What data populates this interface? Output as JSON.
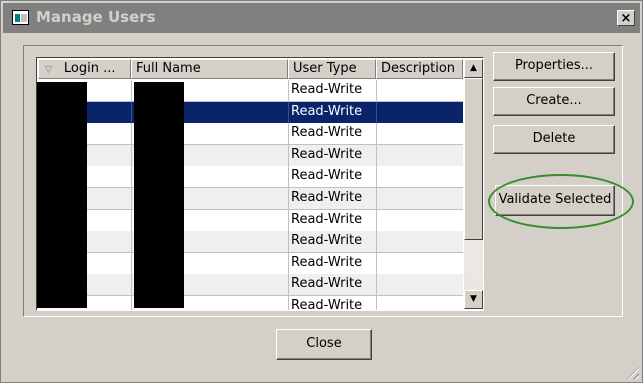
{
  "window": {
    "title": "Manage Users",
    "close_glyph": "×"
  },
  "grid": {
    "columns": [
      "Login ...",
      "Full Name",
      "User Type",
      "Description"
    ],
    "sort_glyph": "▽",
    "rows": [
      {
        "user_type": "Read-Write",
        "description": ""
      },
      {
        "user_type": "Read-Write",
        "description": "",
        "selected": true
      },
      {
        "user_type": "Read-Write",
        "description": ""
      },
      {
        "user_type": "Read-Write",
        "description": ""
      },
      {
        "user_type": "Read-Write",
        "description": ""
      },
      {
        "user_type": "Read-Write",
        "description": ""
      },
      {
        "user_type": "Read-Write",
        "description": ""
      },
      {
        "user_type": "Read-Write",
        "description": ""
      },
      {
        "user_type": "Read-Write",
        "description": ""
      },
      {
        "user_type": "Read-Write",
        "description": ""
      },
      {
        "user_type": "Read-Write",
        "description": ""
      }
    ],
    "scroll_up_glyph": "▲",
    "scroll_down_glyph": "▼"
  },
  "buttons": {
    "properties": "Properties...",
    "create": "Create...",
    "delete": "Delete",
    "validate_selected": "Validate Selected",
    "close": "Close"
  },
  "colors": {
    "selection": "#0a246a",
    "annotation_ring": "#3a8a2e",
    "dialog_face": "#d4d0c8"
  }
}
